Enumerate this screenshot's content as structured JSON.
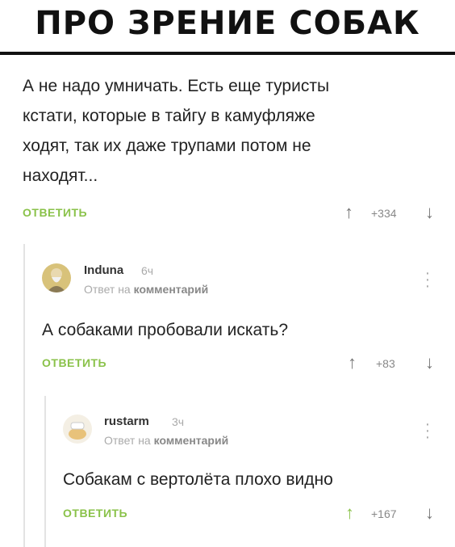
{
  "header": {
    "title": "ПРО ЗРЕНИЕ СОБАК"
  },
  "comments": [
    {
      "text_lines": [
        "А не надо умничать. Есть еще туристы",
        "кстати, которые в тайгу в камуфляже",
        "ходят, так их даже трупами потом не",
        "находят..."
      ],
      "reply_label": "ОТВЕТИТЬ",
      "rating": "+334"
    },
    {
      "author": "Induna",
      "time": "6ч",
      "reply_to_prefix": "Ответ на",
      "reply_to_target": "комментарий",
      "text": "А собаками пробовали искать?",
      "reply_label": "ОТВЕТИТЬ",
      "rating": "+83"
    },
    {
      "author": "rustarm",
      "time": "3ч",
      "reply_to_prefix": "Ответ на",
      "reply_to_target": "комментарий",
      "text": "Собакам с вертолёта плохо видно",
      "reply_label": "ОТВЕТИТЬ",
      "rating": "+167"
    }
  ],
  "icons": {
    "up": "arrow-up-icon",
    "down": "arrow-down-icon",
    "menu": "kebab-menu-icon"
  },
  "colors": {
    "accent_green": "#8ac24a",
    "muted": "#aaaaaa"
  }
}
